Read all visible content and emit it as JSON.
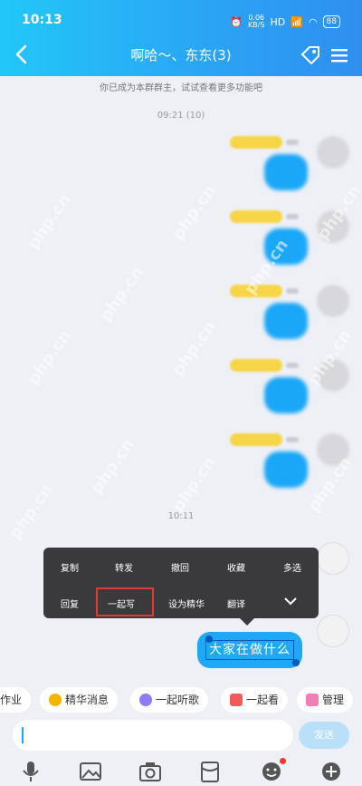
{
  "status": {
    "time": "10:13",
    "net_speed": "0.06",
    "net_unit": "KB/S",
    "net_type": "HD",
    "battery": "88"
  },
  "header": {
    "title": "啊哈～、东东(3)"
  },
  "notice": "你已成为本群群主，试试查看更多功能吧",
  "timestamp_top": "09:21 (10)",
  "timestamp_mid": "10:11",
  "context_menu": {
    "row1": [
      "复制",
      "转发",
      "撤回",
      "收藏",
      "多选"
    ],
    "row2": [
      "回复",
      "一起写",
      "设为精华",
      "翻译"
    ]
  },
  "selected_message": {
    "text": "大家在做什么"
  },
  "shortcuts": [
    "作业",
    "精华消息",
    "一起听歌",
    "一起看",
    "管理"
  ],
  "input": {
    "value": "",
    "send_label": "发送"
  },
  "watermark": "php.cn",
  "colors": {
    "header_start": "#22c7f7",
    "header_end": "#2f8ff0",
    "bubble": "#1aa7f7",
    "menu_bg": "#3a3a3d",
    "highlight": "#e53935"
  },
  "icons": {
    "mic": "mic-icon",
    "image": "image-icon",
    "camera": "camera-icon",
    "redpacket": "red-packet-icon",
    "emoji": "emoji-icon",
    "plus": "plus-icon"
  }
}
